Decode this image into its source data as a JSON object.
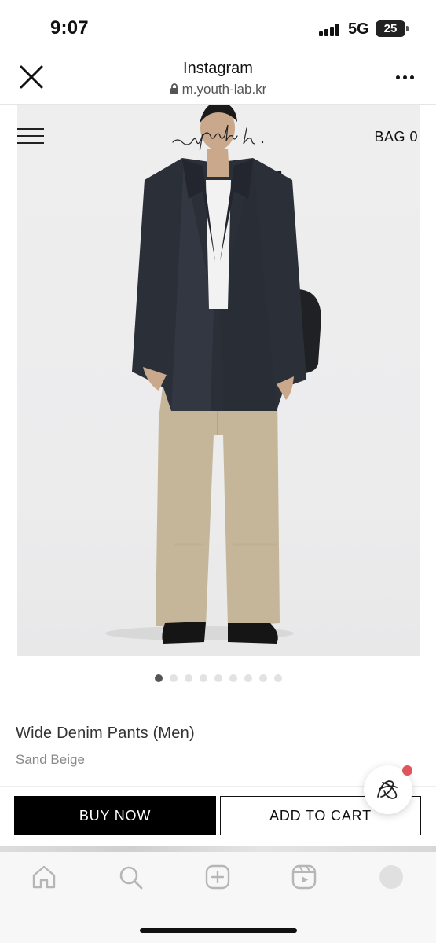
{
  "status_bar": {
    "time": "9:07",
    "network": "5G",
    "battery": "25"
  },
  "browser": {
    "title": "Instagram",
    "url": "m.youth-lab.kr"
  },
  "site_header": {
    "brand": "~youth.",
    "bag_label": "BAG 0"
  },
  "carousel": {
    "total": 9,
    "active_index": 0
  },
  "product": {
    "name": "Wide Denim Pants (Men)",
    "color": "Sand Beige"
  },
  "actions": {
    "buy_now": "BUY NOW",
    "add_to_cart": "ADD TO CART"
  },
  "colors": {
    "accent": "#000000",
    "badge": "#e0555c",
    "jacket": "#2b2f38",
    "pants": "#c5b699"
  },
  "icons": {
    "close": "close-icon",
    "lock": "lock-icon",
    "more": "more-icon",
    "menu": "hamburger-icon",
    "chat": "chat-icon",
    "nav": [
      "home-icon",
      "search-icon",
      "create-icon",
      "reels-icon",
      "profile-icon"
    ]
  }
}
